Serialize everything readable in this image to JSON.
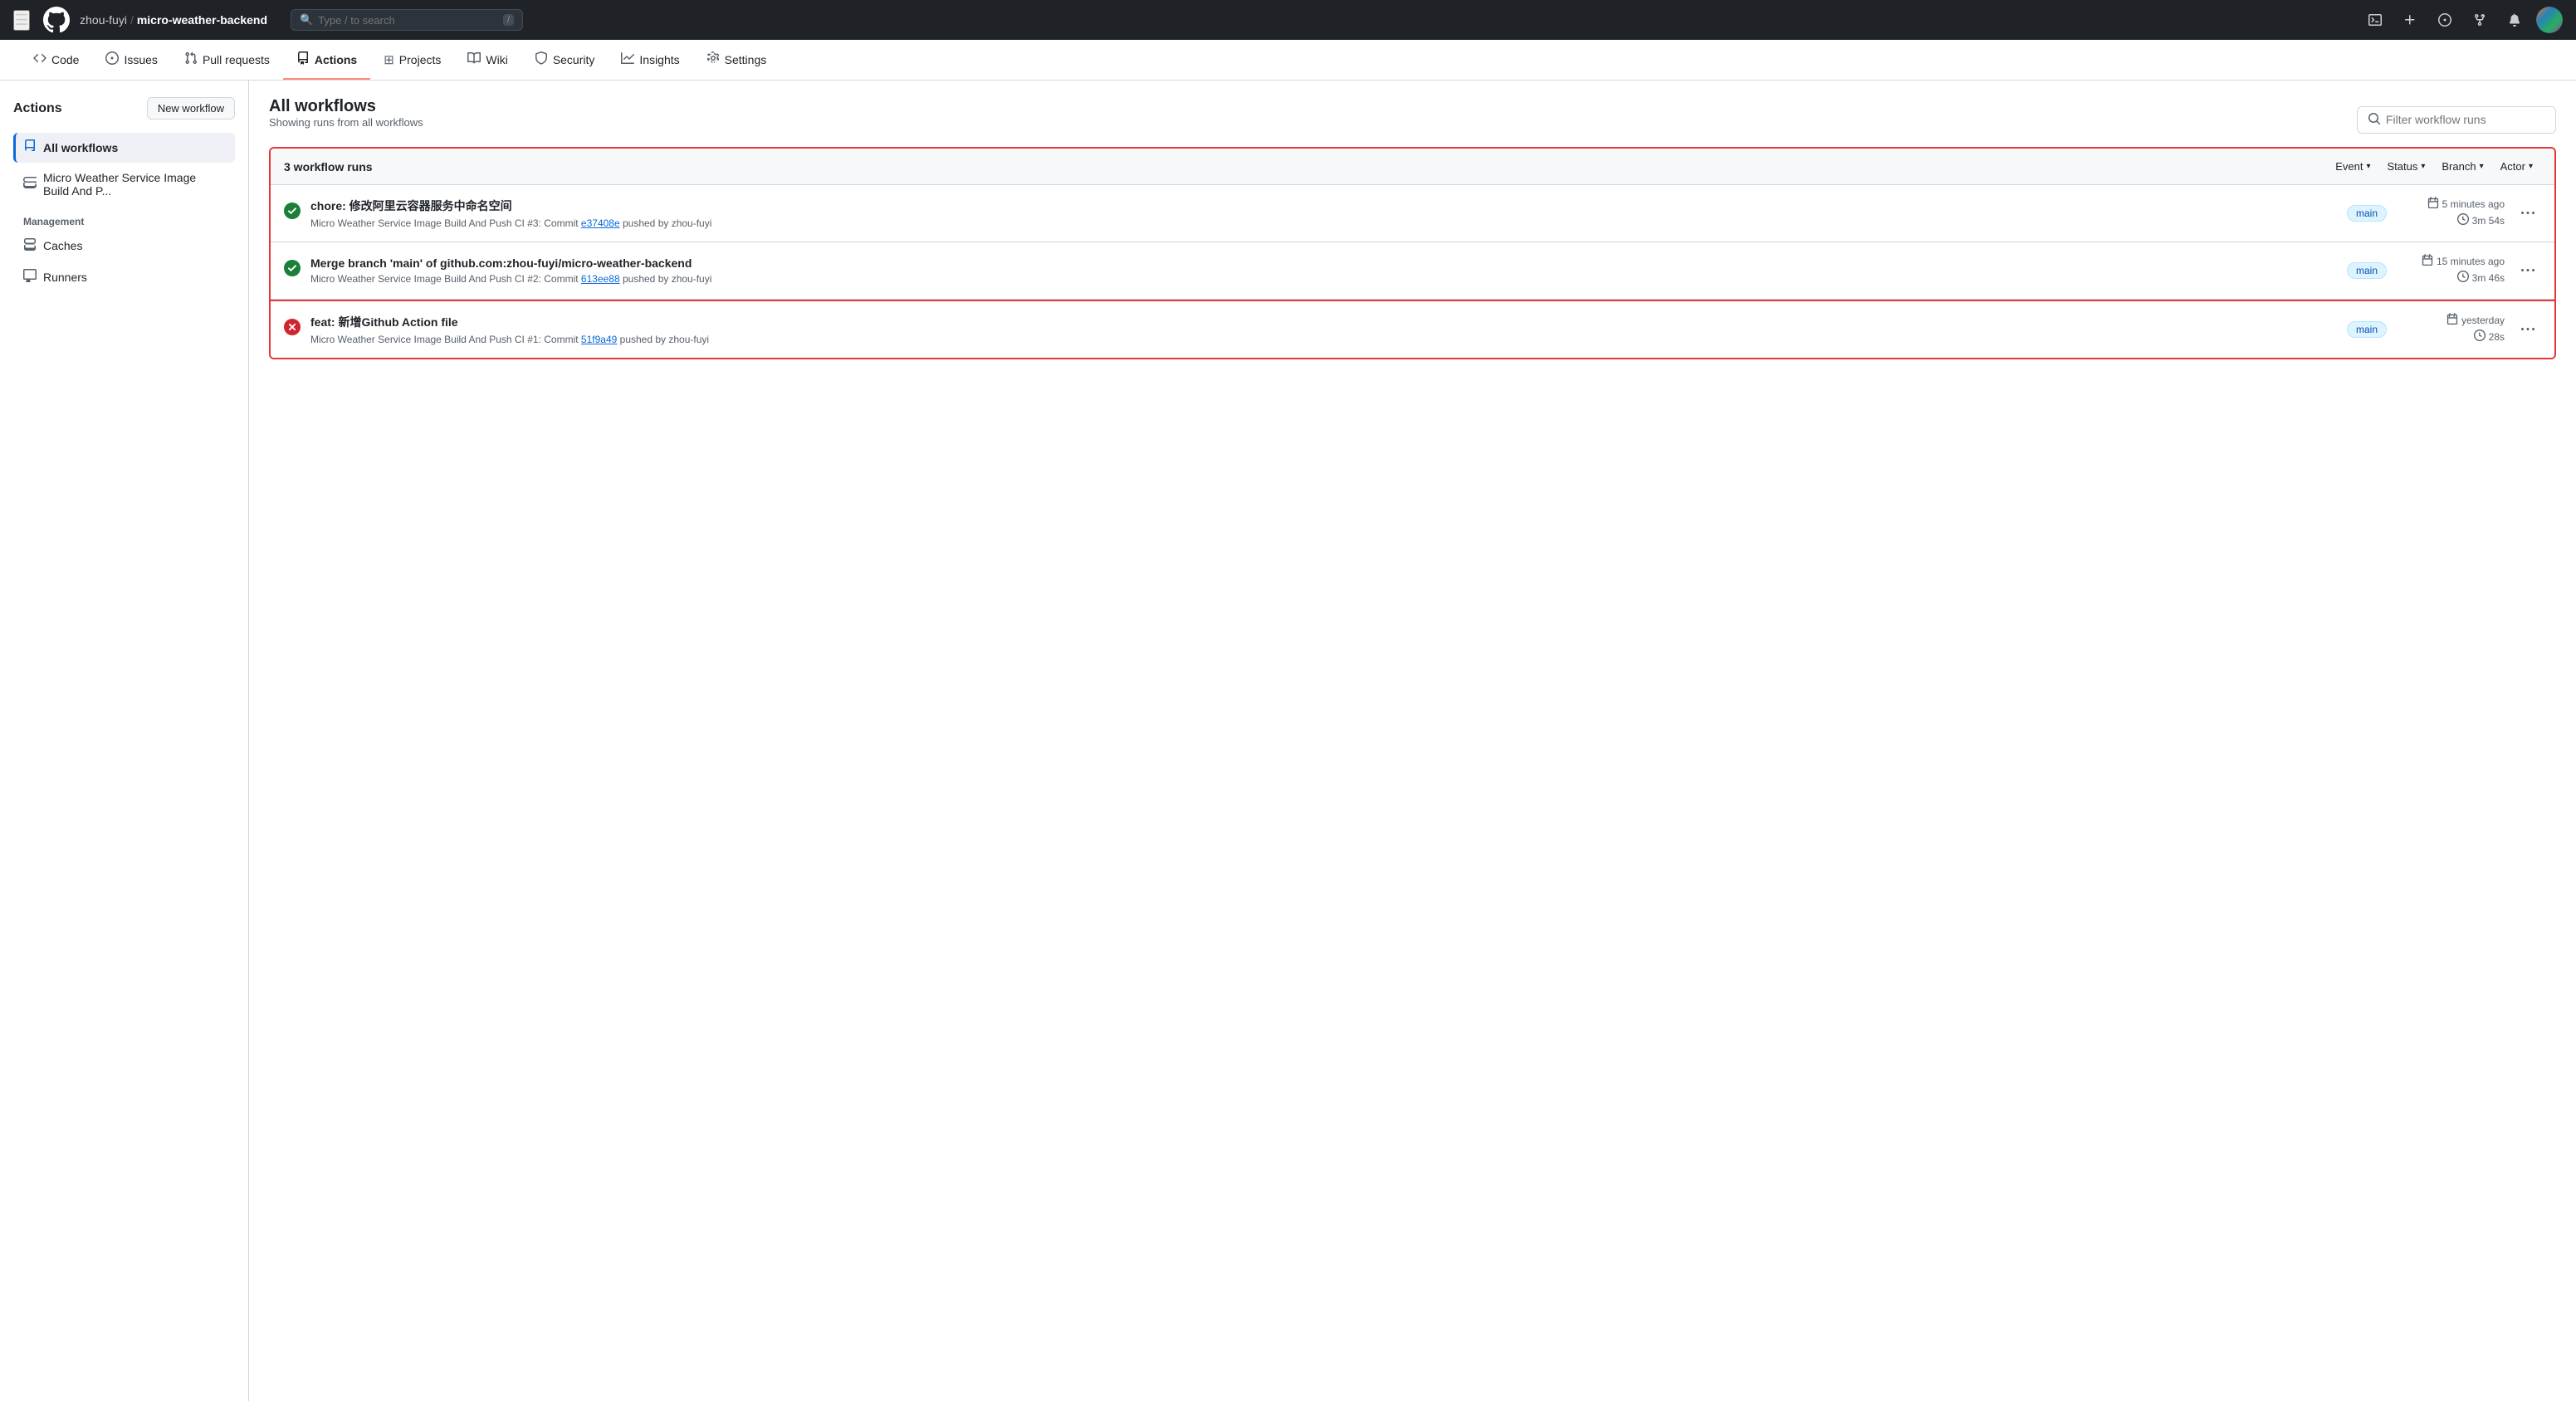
{
  "topnav": {
    "hamburger": "☰",
    "breadcrumb_user": "zhou-fuyi",
    "breadcrumb_sep": "/",
    "breadcrumb_repo": "micro-weather-backend",
    "search_placeholder": "Type / to search",
    "search_kbd": "/"
  },
  "reponav": {
    "items": [
      {
        "id": "code",
        "label": "Code",
        "icon": "◇"
      },
      {
        "id": "issues",
        "label": "Issues",
        "icon": "○"
      },
      {
        "id": "pull-requests",
        "label": "Pull requests",
        "icon": "⑂"
      },
      {
        "id": "actions",
        "label": "Actions",
        "icon": "▷",
        "active": true
      },
      {
        "id": "projects",
        "label": "Projects",
        "icon": "⊞"
      },
      {
        "id": "wiki",
        "label": "Wiki",
        "icon": "📖"
      },
      {
        "id": "security",
        "label": "Security",
        "icon": "🛡"
      },
      {
        "id": "insights",
        "label": "Insights",
        "icon": "📈"
      },
      {
        "id": "settings",
        "label": "Settings",
        "icon": "⚙"
      }
    ]
  },
  "sidebar": {
    "title": "Actions",
    "new_workflow_label": "New workflow",
    "all_workflows_label": "All workflows",
    "workflow_items": [
      {
        "id": "micro-weather",
        "label": "Micro Weather Service Image Build And P..."
      }
    ],
    "management_label": "Management",
    "management_items": [
      {
        "id": "caches",
        "label": "Caches",
        "icon": "◱"
      },
      {
        "id": "runners",
        "label": "Runners",
        "icon": "▦"
      }
    ]
  },
  "main": {
    "title": "All workflows",
    "showing_text": "Showing runs from all workflows",
    "filter_placeholder": "Filter workflow runs",
    "workflow_count": "3 workflow runs",
    "filter_event": "Event",
    "filter_status": "Status",
    "filter_branch": "Branch",
    "filter_actor": "Actor",
    "runs": [
      {
        "id": 1,
        "status": "success",
        "status_icon": "✅",
        "title": "chore: 修改阿里云容器服务中命名空间",
        "subtitle_prefix": "Micro Weather Service Image Build And Push CI #3: Commit",
        "commit_hash": "e37408e",
        "subtitle_suffix": "pushed by zhou-fuyi",
        "branch": "main",
        "time_ago": "5 minutes ago",
        "duration": "3m 54s",
        "inside_border": true
      },
      {
        "id": 2,
        "status": "success",
        "status_icon": "✅",
        "title": "Merge branch 'main' of github.com:zhou-fuyi/micro-weather-backend",
        "subtitle_prefix": "Micro Weather Service Image Build And Push CI #2: Commit",
        "commit_hash": "613ee88",
        "subtitle_suffix": "pushed by zhou-fuyi",
        "branch": "main",
        "time_ago": "15 minutes ago",
        "duration": "3m 46s",
        "inside_border": true
      },
      {
        "id": 3,
        "status": "failure",
        "status_icon": "❌",
        "title": "feat: 新增Github Action file",
        "subtitle_prefix": "Micro Weather Service Image Build And Push CI #1: Commit",
        "commit_hash": "51f9a49",
        "subtitle_suffix": "pushed by zhou-fuyi",
        "branch": "main",
        "time_ago": "yesterday",
        "duration": "28s",
        "inside_border": false
      }
    ]
  }
}
